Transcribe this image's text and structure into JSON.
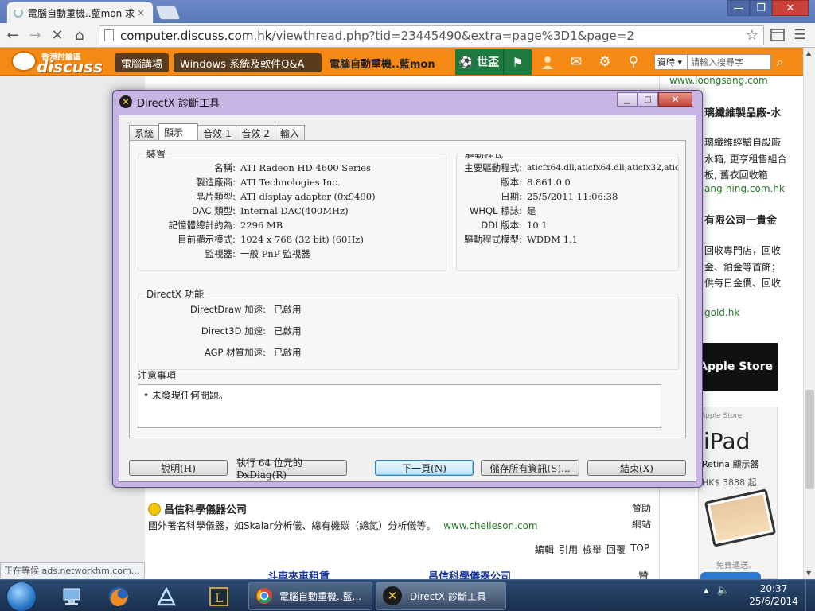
{
  "browser": {
    "tab_title": "電腦自動重機..藍mon 求解",
    "tab_close": "×",
    "url_host": "computer.discuss.com.hk",
    "url_path": "/viewthread.php?tid=23445490&extra=page%3D1&page=2",
    "window_minimize": "—",
    "window_maximize": "❐",
    "window_close": "✕",
    "back": "←",
    "forward": "→",
    "stop": "✕",
    "home": "⌂",
    "star": "☆",
    "menu": "☰"
  },
  "site": {
    "logo_line1": "香港討論區",
    "logo_line2": "discuss",
    "nav_computer": "電腦講場",
    "nav_windows": "Windows 系統及軟件Q&A",
    "thread_title": "電腦自動重機..藍mon",
    "worldcup_label": "⚽ 世盃",
    "search_select": "資時 ▾",
    "search_placeholder": "請輸入搜尋字",
    "search_icon": "⌕",
    "icons": [
      "user-icon",
      "mail-icon",
      "settings-icon",
      "link-icon"
    ]
  },
  "sidebar": {
    "link1": "www.loongsang.com",
    "head1": "璃纖維製品廠-水",
    "text1": "璃纖維經驗自設廠",
    "text2": "水箱, 更亨租售組合",
    "text3": "板, 舊衣回收箱",
    "link2": "ang-hing.com.hk",
    "head2": "有限公司一貴金",
    "text4": "回收專門店，回收",
    "text5": "金、鉑金等首飾；",
    "text6": "供每日金價、回收",
    "link3": "gold.hk",
    "apple_store": "Apple Store",
    "ipad_small": "Apple Store",
    "ipad_name": "iPad",
    "ipad_display": "Retina 顯示器",
    "ipad_price": "HK$ 3888 起",
    "free_shipping": "免費運送。"
  },
  "page": {
    "sponsor_title": "昌信科學儀器公司",
    "sponsor_desc": "國外著名科學儀器，如Skalar分析儀、總有機碳（總氮）分析儀等。",
    "sponsor_url": "www.chelleson.com",
    "sponsor_side1": "贊助",
    "sponsor_side2": "網站",
    "actions": [
      "編輯",
      "引用",
      "檢舉",
      "回覆",
      "TOP"
    ],
    "next_link1": "斗車夾車租賃",
    "next_link2": "昌信科學儀器公司",
    "next_side": "贊",
    "status_text": "正在等候 ads.networkhm.com..."
  },
  "dxdiag": {
    "title": "DirectX 診斷工具",
    "tabs": [
      "系統",
      "顯示",
      "音效 1",
      "音效 2",
      "輸入"
    ],
    "selected_tab": "顯示",
    "device_group": "裝置",
    "device": [
      {
        "k": "名稱:",
        "v": "ATI Radeon HD 4600 Series"
      },
      {
        "k": "製造廠商:",
        "v": "ATI Technologies Inc."
      },
      {
        "k": "晶片類型:",
        "v": "ATI display adapter (0x9490)"
      },
      {
        "k": "DAC 類型:",
        "v": "Internal DAC(400MHz)"
      },
      {
        "k": "記憶體總計約為:",
        "v": "2296 MB"
      },
      {
        "k": "目前顯示模式:",
        "v": "1024 x 768 (32 bit) (60Hz)"
      },
      {
        "k": "監視器:",
        "v": "一般 PnP 監視器"
      }
    ],
    "driver_group": "驅動程式",
    "driver": [
      {
        "k": "主要驅動程式:",
        "v": "aticfx64.dll,aticfx64.dll,aticfx32,aticf>"
      },
      {
        "k": "版本:",
        "v": "8.861.0.0"
      },
      {
        "k": "日期:",
        "v": "25/5/2011 11:06:38"
      },
      {
        "k": "WHQL 標誌:",
        "v": "是"
      },
      {
        "k": "DDI 版本:",
        "v": "10.1"
      },
      {
        "k": "驅動程式模型:",
        "v": "WDDM 1.1"
      }
    ],
    "features_group": "DirectX 功能",
    "features": [
      {
        "k": "DirectDraw 加速:",
        "v": "已啟用"
      },
      {
        "k": "Direct3D 加速:",
        "v": "已啟用"
      },
      {
        "k": "AGP 材質加速:",
        "v": "已啟用"
      }
    ],
    "notes_group": "注意事項",
    "notes": "•    未發現任何問題。",
    "buttons": {
      "help": "說明(H)",
      "run64": "執行 64 位元的 DxDiag(R)",
      "next": "下一頁(N)",
      "save": "儲存所有資訊(S)...",
      "exit": "結束(X)"
    }
  },
  "taskbar": {
    "app_chrome": "電腦自動重機..藍...",
    "app_dxdiag": "DirectX 診斷工具",
    "time": "20:37",
    "date": "25/6/2014"
  }
}
